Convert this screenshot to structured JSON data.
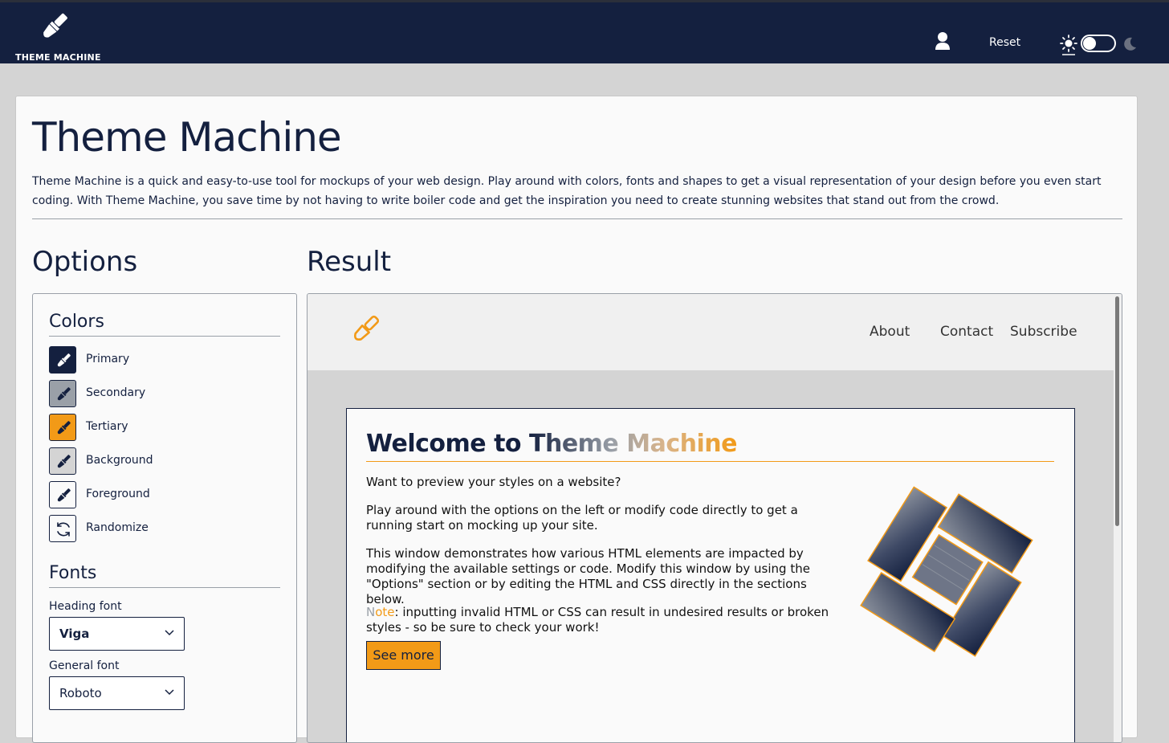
{
  "navbar": {
    "brand": "THEME MACHINE",
    "brand_icon": "paintbrush-icon",
    "user_icon": "user-icon",
    "reset_label": "Reset",
    "theme_toggle": {
      "light_icon": "sun-icon",
      "dark_icon": "moon-icon",
      "mode": "light"
    }
  },
  "page": {
    "title": "Theme Machine",
    "intro": "Theme Machine is a quick and easy-to-use tool for mockups of your web design. Play around with colors, fonts and shapes to get a visual representation of your design before you even start coding. With Theme Machine, you save time by not having to write boiler code and get the inspiration you need to create stunning websites that stand out from the crowd."
  },
  "options": {
    "heading": "Options",
    "colors_title": "Colors",
    "colors": [
      {
        "label": "Primary",
        "color": "#14203f",
        "icon": "brush-icon"
      },
      {
        "label": "Secondary",
        "color": "#9aa0a8",
        "icon": "brush-icon"
      },
      {
        "label": "Tertiary",
        "color": "#f29a17",
        "icon": "brush-icon"
      },
      {
        "label": "Background",
        "color": "#d4d4d4",
        "icon": "brush-icon"
      },
      {
        "label": "Foreground",
        "color": "#fafafa",
        "icon": "brush-icon"
      },
      {
        "label": "Randomize",
        "icon": "refresh-icon"
      }
    ],
    "fonts_title": "Fonts",
    "heading_font_label": "Heading font",
    "heading_font": "Viga",
    "general_font_label": "General font",
    "general_font": "Roboto"
  },
  "result": {
    "heading": "Result",
    "nav_links": [
      "About",
      "Contact",
      "Subscribe"
    ],
    "welcome_a": "Welcome to ",
    "welcome_b": "Theme Machine",
    "p1": "Want to preview your styles on a website?",
    "p2": "Play around with the options on the left or modify code directly to get a running start on mocking up your site.",
    "p3": "This window demonstrates how various HTML elements are impacted by modifying the available settings or code. Modify this window by using the \"Options\" section or by editing the HTML and CSS directly in the sections below.",
    "note_a": "N",
    "note_b": "ote",
    "note_rest": ": inputting invalid HTML or CSS can result in undesired results or broken styles - so be sure to check your work!",
    "button": "See more"
  },
  "colors": {
    "primary": "#14203f",
    "secondary": "#9aa0a8",
    "tertiary": "#f29a17",
    "background": "#d4d4d4",
    "foreground": "#fafafa"
  }
}
